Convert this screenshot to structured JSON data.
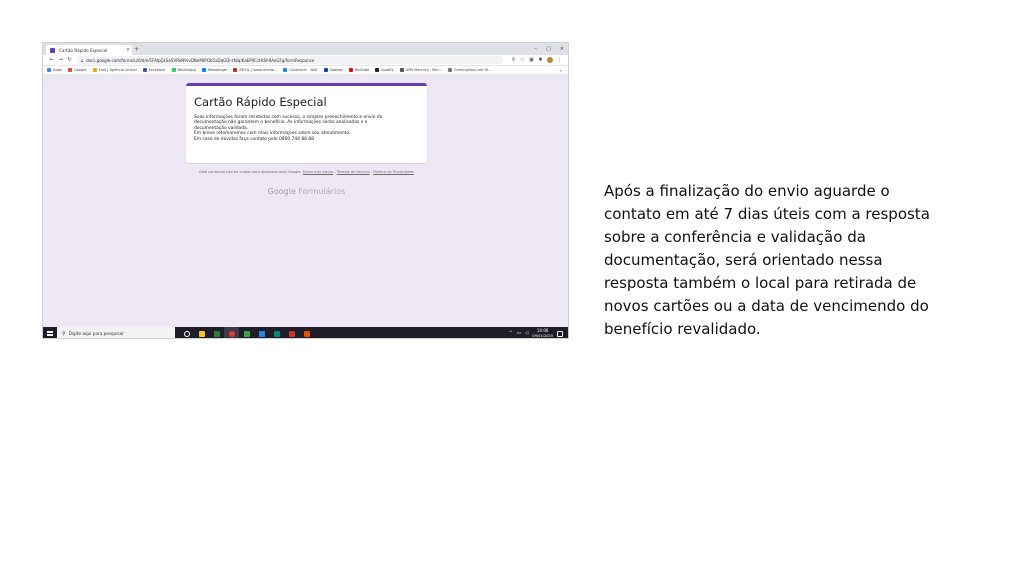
{
  "browser": {
    "tab_title": "Cartão Rápido Especial",
    "tab_close": "×",
    "new_tab": "+",
    "window_controls": [
      "–",
      "□",
      "×"
    ],
    "url": "docs.google.com/forms/u/0/d/e/1FAIpQLSeSVRkN9rvDNeMtPOb5aDqGDr-tNiq/KaEPXCcHtSh9AoGFg/formResponse",
    "bookmarks": [
      {
        "label": "Apps",
        "color": "#4285f4"
      },
      {
        "label": "Google",
        "color": "#ea4335"
      },
      {
        "label": "Exel | Agência virtual",
        "color": "#f4a300"
      },
      {
        "label": "Facebook",
        "color": "#3b5998"
      },
      {
        "label": "WhatsApp",
        "color": "#25d366"
      },
      {
        "label": "Messenger",
        "color": "#0084ff"
      },
      {
        "label": "REVIL | www.revide...",
        "color": "#c62828"
      },
      {
        "label": "Colaborar - AVA",
        "color": "#1e88e5"
      },
      {
        "label": "Sabesp",
        "color": "#0d47a1"
      },
      {
        "label": "YouTube",
        "color": "#ff0000"
      },
      {
        "label": "Spotify",
        "color": "#222222"
      },
      {
        "label": "APB Mercury - Mor...",
        "color": "#555555"
      },
      {
        "label": "ComingSoon.net M...",
        "color": "#777777"
      }
    ],
    "bookmarks_more": "»"
  },
  "form": {
    "title": "Cartão Rápido Especial",
    "message_lines": [
      "Suas informações foram recebidas com sucesso, o simples preenchimento e envio da",
      "documentação não garantem o benefício. As informações serão analisadas e a",
      "documentação validada.",
      "Em breve retomaremos com mais informações sobre seu atendimento.",
      "Em caso de dúvidas faça contato pelo 0800 744 88 88"
    ],
    "disclaimer_text": "Este conteúdo não foi criado nem aprovado pelo Google.",
    "disclaimer_report": "Denunciar abuso",
    "disclaimer_sep1": " - ",
    "disclaimer_terms": "Termos de Serviço",
    "disclaimer_sep2": " - ",
    "disclaimer_privacy": "Política de Privacidade",
    "logo_google": "Google",
    "logo_forms": "Formulários",
    "accent_color": "#673ab7",
    "background_color": "#ede7f6"
  },
  "taskbar": {
    "search_placeholder": "Digite aqui para pesquisar",
    "time": "14:06",
    "date": "09/01/2020",
    "apps": [
      {
        "icon": "task-view-icon",
        "color": "#ffffff"
      },
      {
        "icon": "file-explorer-icon",
        "color": "#f4c430"
      },
      {
        "icon": "store-icon",
        "color": "#2e7d32"
      },
      {
        "icon": "chrome-icon",
        "color": "#e53935"
      },
      {
        "icon": "app-green-icon",
        "color": "#43a047"
      },
      {
        "icon": "app-blue-icon",
        "color": "#1e88e5"
      },
      {
        "icon": "app-teal-icon",
        "color": "#00897b"
      },
      {
        "icon": "acrobat-icon",
        "color": "#d32f2f"
      },
      {
        "icon": "app-orange-icon",
        "color": "#e65100"
      }
    ]
  },
  "description": {
    "lines": [
      "Após a finalização do envio aguarde o",
      "contato em até 7 dias úteis com a resposta",
      "sobre a conferência e validação da",
      "documentação, será orientado nessa",
      "resposta também o local para retirada de",
      "novos cartões ou a data de vencimendo do",
      "benefício revalidado."
    ]
  }
}
